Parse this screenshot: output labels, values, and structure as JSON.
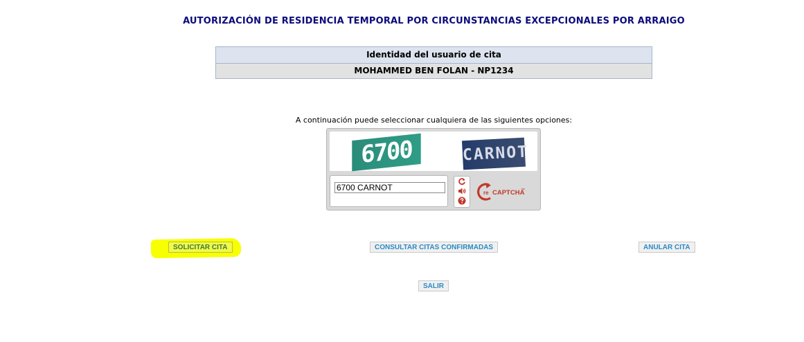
{
  "page": {
    "title": "AUTORIZACIÓN DE RESIDENCIA TEMPORAL POR CIRCUNSTANCIAS EXCEPCIONALES POR ARRAIGO"
  },
  "identity": {
    "header": "Identidad del usuario de cita",
    "value": "MOHAMMED BEN FOLAN - NP1234"
  },
  "instructions": "A continuación puede seleccionar cualquiera de las siguientes opciones:",
  "captcha": {
    "word1": "6700",
    "word2": "CARNOT",
    "input_value": "6700 CARNOT",
    "logo_prefix": "re",
    "logo_text": "CAPTCHA",
    "logo_tm": "™",
    "controls": {
      "refresh_icon": "refresh-icon",
      "audio_icon": "speaker-icon",
      "help_icon": "help-icon"
    },
    "colors": {
      "icon_red": "#c0392b",
      "word1_bg": "#2a8c7a",
      "word2_bg": "#243c6a"
    }
  },
  "actions": {
    "solicitar": "SOLICITAR CITA",
    "consultar": "CONSULTAR CITAS CONFIRMADAS",
    "anular": "ANULAR CITA",
    "salir": "SALIR"
  },
  "colors": {
    "title": "#0b0b7c",
    "button_text": "#2b8ac4",
    "highlight": "#f7ff00"
  }
}
